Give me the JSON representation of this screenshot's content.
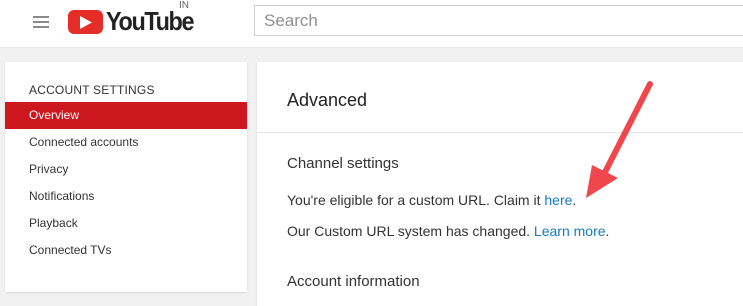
{
  "masthead": {
    "logo_text": "YouTube",
    "country_code": "IN",
    "search_placeholder": "Search"
  },
  "sidebar": {
    "heading": "ACCOUNT SETTINGS",
    "items": [
      {
        "label": "Overview",
        "active": true
      },
      {
        "label": "Connected accounts",
        "active": false
      },
      {
        "label": "Privacy",
        "active": false
      },
      {
        "label": "Notifications",
        "active": false
      },
      {
        "label": "Playback",
        "active": false
      },
      {
        "label": "Connected TVs",
        "active": false
      }
    ]
  },
  "main": {
    "title": "Advanced",
    "channel_settings": {
      "heading": "Channel settings",
      "line1_prefix": "You're eligible for a custom URL. Claim it ",
      "line1_link": "here",
      "line1_suffix": ".",
      "line2_prefix": "Our Custom URL system has changed. ",
      "line2_link": "Learn more",
      "line2_suffix": "."
    },
    "account_information": {
      "heading": "Account information"
    }
  },
  "annotation": {
    "icon": "red-arrow-icon",
    "color": "#f0474d"
  },
  "colors": {
    "brand_red": "#e52d27",
    "active_nav": "#cc181e",
    "link_blue": "#167ac6"
  }
}
